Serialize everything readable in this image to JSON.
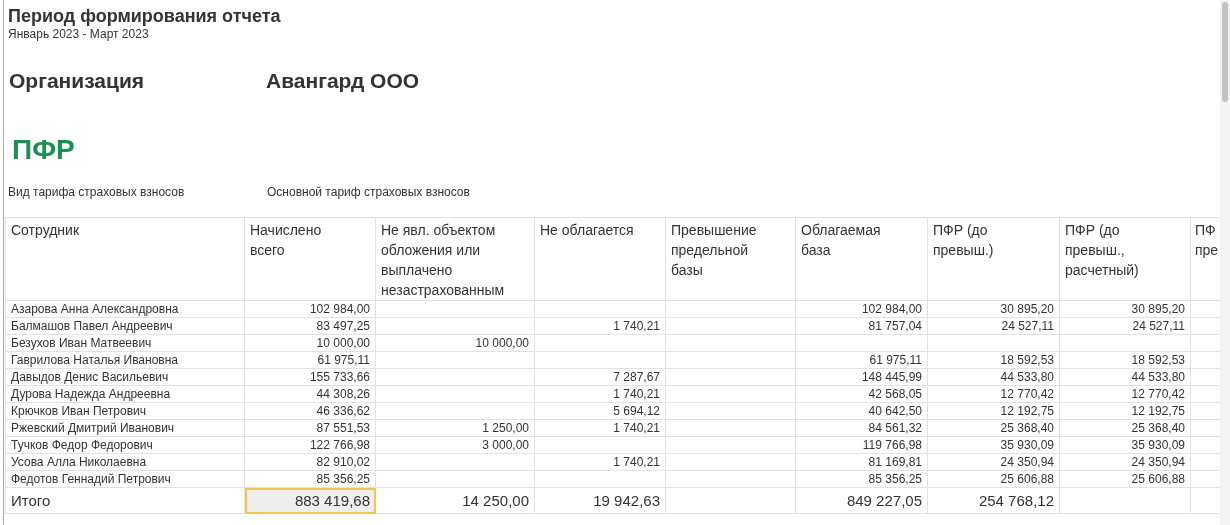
{
  "report_period": {
    "title": "Период формирования отчета",
    "value": "Январь 2023 - Март 2023"
  },
  "organization": {
    "label": "Организация",
    "value": "Авангард ООО"
  },
  "section_title": "ПФР",
  "tariff": {
    "label": "Вид тарифа страховых взносов",
    "value": "Основной тариф страховых взносов"
  },
  "table": {
    "columns": [
      "Сотрудник",
      "Начислено всего",
      "Не явл. объектом обложения или выплачено незастрахованным",
      "Не облагается",
      "Превышение предельной базы",
      "Облагаемая база",
      "ПФР (до превыш.)",
      "ПФР (до превыш., расчетный)",
      "ПФ пре"
    ],
    "rows": [
      [
        "Азарова Анна Александровна",
        "102 984,00",
        null,
        null,
        null,
        "102 984,00",
        "30 895,20",
        "30 895,20"
      ],
      [
        "Балмашов Павел Андреевич",
        "83 497,25",
        null,
        "1 740,21",
        null,
        "81 757,04",
        "24 527,11",
        "24 527,11"
      ],
      [
        "Безухов Иван Матвеевич",
        "10 000,00",
        "10 000,00",
        null,
        null,
        null,
        null,
        null
      ],
      [
        "Гаврилова Наталья Ивановна",
        "61 975,11",
        null,
        null,
        null,
        "61 975,11",
        "18 592,53",
        "18 592,53"
      ],
      [
        "Давыдов Денис Васильевич",
        "155 733,66",
        null,
        "7 287,67",
        null,
        "148 445,99",
        "44 533,80",
        "44 533,80"
      ],
      [
        "Дурова Надежда Андреевна",
        "44 308,26",
        null,
        "1 740,21",
        null,
        "42 568,05",
        "12 770,42",
        "12 770,42"
      ],
      [
        "Крючков Иван Петрович",
        "46 336,62",
        null,
        "5 694,12",
        null,
        "40 642,50",
        "12 192,75",
        "12 192,75"
      ],
      [
        "Ржевский Дмитрий Иванович",
        "87 551,53",
        "1 250,00",
        "1 740,21",
        null,
        "84 561,32",
        "25 368,40",
        "25 368,40"
      ],
      [
        "Тучков Федор Федорович",
        "122 766,98",
        "3 000,00",
        null,
        null,
        "119 766,98",
        "35 930,09",
        "35 930,09"
      ],
      [
        "Усова Алла Николаевна",
        "82 910,02",
        null,
        "1 740,21",
        null,
        "81 169,81",
        "24 350,94",
        "24 350,94"
      ],
      [
        "Федотов Геннадий Петрович",
        "85 356,25",
        null,
        null,
        null,
        "85 356,25",
        "25 606,88",
        "25 606,88"
      ]
    ],
    "total": [
      {
        "text": "Итого",
        "selected": false
      },
      {
        "text": "883 419,68",
        "selected": true
      },
      {
        "text": "14 250,00",
        "selected": false
      },
      {
        "text": "19 942,63",
        "selected": false
      },
      {
        "selected": false
      },
      {
        "text": "849 227,05",
        "selected": false
      },
      {
        "text": "254 768,12",
        "selected": false
      },
      {
        "selected": false
      }
    ]
  }
}
